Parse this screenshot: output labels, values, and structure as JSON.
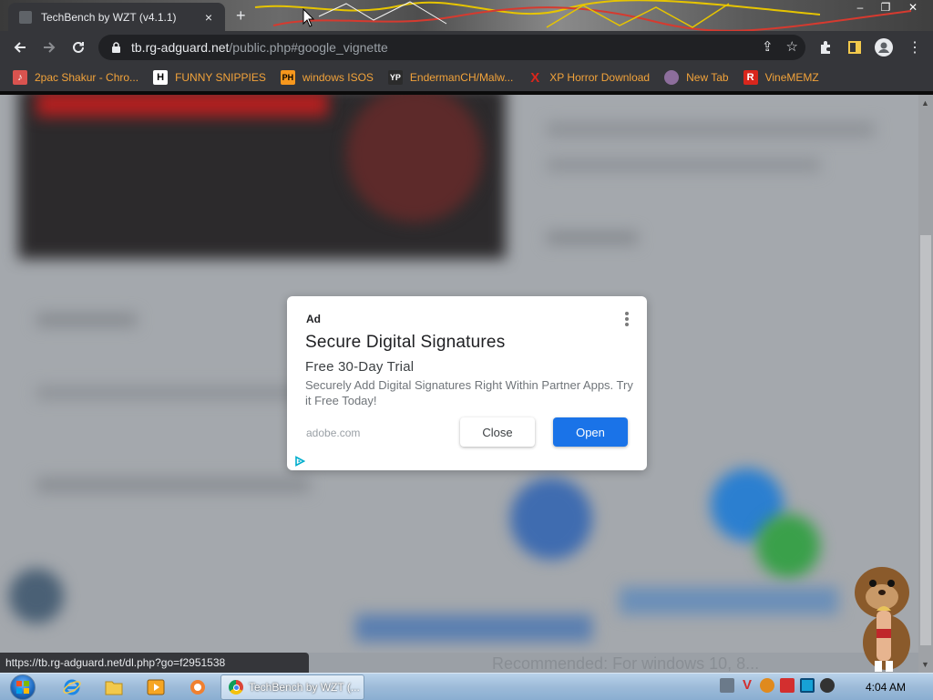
{
  "browser": {
    "tab_title": "TechBench by WZT (v4.1.1)",
    "tab_close": "×",
    "new_tab": "+",
    "url_host": "tb.rg-adguard.net",
    "url_path": "/public.php#google_vignette"
  },
  "bookmarks": [
    {
      "label": "2pac Shakur - Chro...",
      "icon": "music-icon",
      "icon_text": "",
      "color": "#d9534f"
    },
    {
      "label": "FUNNY SNIPPIES",
      "icon": "h-icon",
      "icon_text": "H",
      "color": "#ffffff"
    },
    {
      "label": "windows ISOS",
      "icon": "ph-icon",
      "icon_text": "PH",
      "color": "#f7971d"
    },
    {
      "label": "EndermanCH/Malw...",
      "icon": "yp-icon",
      "icon_text": "YP",
      "color": "#2b2b2b"
    },
    {
      "label": "XP Horror Download",
      "icon": "x-icon",
      "icon_text": "X",
      "color": "#d9261c"
    },
    {
      "label": "New Tab",
      "icon": "newtab-icon",
      "icon_text": "",
      "color": "#8d6e9c"
    },
    {
      "label": "VineMEMZ",
      "icon": "r-icon",
      "icon_text": "R",
      "color": "#d9261c"
    }
  ],
  "ad": {
    "label": "Ad",
    "headline": "Secure Digital Signatures",
    "subheadline": "Free 30-Day Trial",
    "description": "Securely Add Digital Signatures Right Within Partner Apps. Try it Free Today!",
    "domain": "adobe.com",
    "close_label": "Close",
    "open_label": "Open"
  },
  "status_url": "https://tb.rg-adguard.net/dl.php?go=f2951538",
  "faded_page_text": "Recommended: For windows 10, 8...",
  "taskbar": {
    "task_label": "TechBench by WZT (...",
    "clock": "4:04 AM"
  },
  "colors": {
    "accent": "#1a73e8",
    "chrome_dark": "#35363a",
    "bookmark_text": "#f2a33a"
  }
}
